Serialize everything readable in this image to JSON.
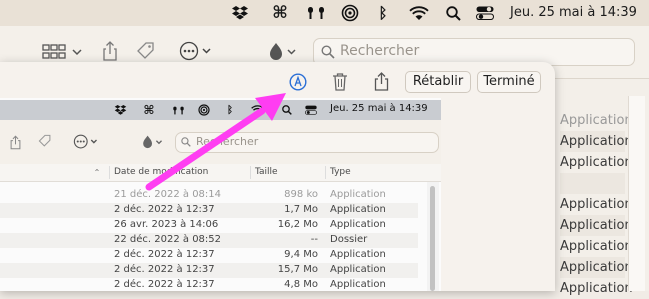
{
  "menubar": {
    "icons": [
      "dropbox-icon",
      "command-icon",
      "airpods-icon",
      "airdrop-icon",
      "bluetooth-icon",
      "wifi-icon",
      "search-icon",
      "control-center-icon"
    ],
    "datetime": "Jeu. 25 mai à 14:39"
  },
  "toolbar": {
    "search_placeholder": "Rechercher",
    "icons": [
      "view-grid-icon",
      "share-icon",
      "tag-icon",
      "more-icon",
      "dropbox-icon"
    ]
  },
  "markup": {
    "icons": [
      "markup-annotate-icon",
      "trash-icon",
      "share-icon"
    ],
    "revert_label": "Rétablir",
    "done_label": "Terminé",
    "annotation_color": "#ff3df2"
  },
  "screenshot": {
    "menubar": {
      "datetime": "Jeu. 25 mai à 14:39"
    },
    "toolbar": {
      "search_placeholder": "Rechercher"
    },
    "columns": {
      "date": "Date de modification",
      "size": "Taille",
      "type": "Type"
    },
    "rows": [
      {
        "date": "21 déc. 2022 à 08:14",
        "size": "898 ko",
        "type": "Application"
      },
      {
        "date": "2 déc. 2022 à 12:37",
        "size": "1,7 Mo",
        "type": "Application"
      },
      {
        "date": "26 avr. 2023 à 14:06",
        "size": "16,2 Mo",
        "type": "Application"
      },
      {
        "date": "22 déc. 2022 à 08:52",
        "size": "--",
        "type": "Dossier"
      },
      {
        "date": "2 déc. 2022 à 12:37",
        "size": "9,4 Mo",
        "type": "Application"
      },
      {
        "date": "2 déc. 2022 à 12:37",
        "size": "15,7 Mo",
        "type": "Application"
      },
      {
        "date": "2 déc. 2022 à 12:37",
        "size": "4,8 Mo",
        "type": "Application"
      }
    ]
  },
  "background_list": {
    "items": [
      "Application",
      "Application",
      "Application",
      "",
      "Application",
      "Application",
      "Application",
      "Application",
      "Application",
      "Application"
    ]
  }
}
